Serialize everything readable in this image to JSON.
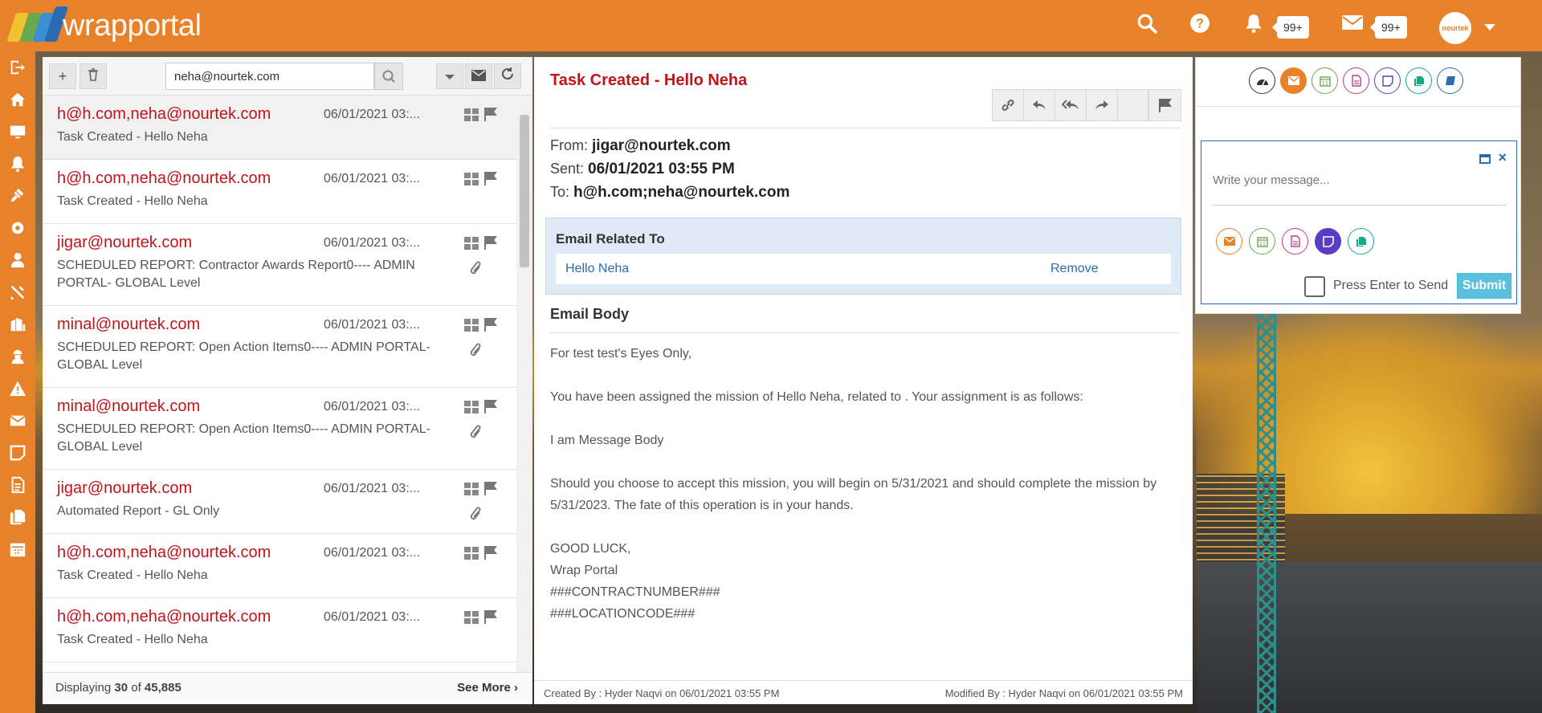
{
  "header": {
    "logo_text": "wrapportal",
    "notifications_count": "99+",
    "messages_count": "99+",
    "avatar_text": "nourtek"
  },
  "list": {
    "search_value": "neha@nourtek.com",
    "items": [
      {
        "from": "h@h.com,neha@nourtek.com",
        "date": "06/01/2021 03:...",
        "subject": "Task Created - Hello Neha",
        "attachment": false
      },
      {
        "from": "h@h.com,neha@nourtek.com",
        "date": "06/01/2021 03:...",
        "subject": "Task Created - Hello Neha",
        "attachment": false
      },
      {
        "from": "jigar@nourtek.com",
        "date": "06/01/2021 03:...",
        "subject": "SCHEDULED REPORT: Contractor Awards Report0---- ADMIN PORTAL- GLOBAL Level",
        "attachment": true
      },
      {
        "from": "minal@nourtek.com",
        "date": "06/01/2021 03:...",
        "subject": "SCHEDULED REPORT: Open Action Items0---- ADMIN PORTAL- GLOBAL Level",
        "attachment": true
      },
      {
        "from": "minal@nourtek.com",
        "date": "06/01/2021 03:...",
        "subject": "SCHEDULED REPORT: Open Action Items0---- ADMIN PORTAL- GLOBAL Level",
        "attachment": true
      },
      {
        "from": "jigar@nourtek.com",
        "date": "06/01/2021 03:...",
        "subject": "Automated Report - GL Only",
        "attachment": true
      },
      {
        "from": "h@h.com,neha@nourtek.com",
        "date": "06/01/2021 03:...",
        "subject": "Task Created - Hello Neha",
        "attachment": false
      },
      {
        "from": "h@h.com,neha@nourtek.com",
        "date": "06/01/2021 03:...",
        "subject": "Task Created - Hello Neha",
        "attachment": false
      }
    ],
    "footer_prefix": "Displaying",
    "footer_shown": "30",
    "footer_of": "of",
    "footer_total": "45,885",
    "see_more": "See More"
  },
  "mail": {
    "title": "Task Created - Hello Neha",
    "from_label": "From:",
    "from_value": "jigar@nourtek.com",
    "sent_label": "Sent:",
    "sent_value": "06/01/2021 03:55 PM",
    "to_label": "To:",
    "to_value": "h@h.com;neha@nourtek.com",
    "related_heading": "Email Related To",
    "related_link": "Hello Neha",
    "related_remove": "Remove",
    "body_heading": "Email Body",
    "body": {
      "line1": "For test test's Eyes Only,",
      "line2": "You have been assigned the mission of Hello Neha, related to . Your assignment is as follows:",
      "line3": "I am Message Body",
      "line4": "Should you choose to accept this mission, you will begin on 5/31/2021 and should complete the mission by 5/31/2023. The fate of this operation is in your hands.",
      "line5": "GOOD LUCK,",
      "line6": "Wrap Portal",
      "line7": "###CONTRACTNUMBER###",
      "line8": "###LOCATIONCODE###"
    },
    "created_by": "Created By : Hyder Naqvi on 06/01/2021 03:55 PM",
    "modified_by": "Modified By : Hyder Naqvi on 06/01/2021 03:55 PM"
  },
  "composer": {
    "placeholder": "Write your message...",
    "press_enter_label": "Press Enter to Send",
    "submit_label": "Submit"
  },
  "colors": {
    "brand_orange": "#e8822a",
    "sender_red": "#c0141a",
    "link_blue": "#2b6cb0"
  }
}
